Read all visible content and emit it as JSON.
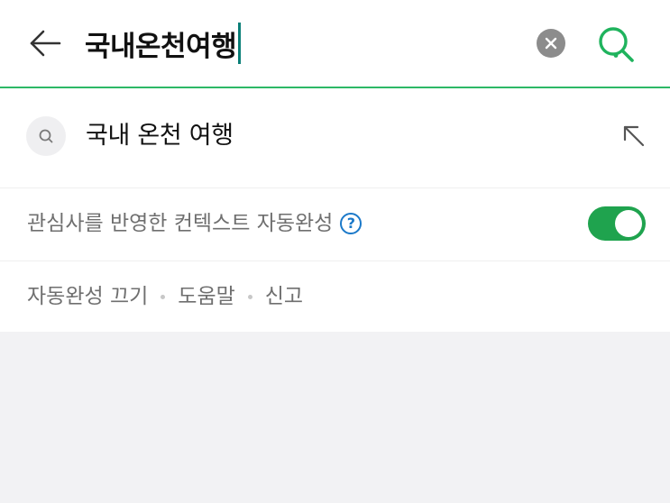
{
  "search": {
    "query": "국내온천여행"
  },
  "suggestions": [
    {
      "text": "국내 온천 여행"
    }
  ],
  "context_autocomplete": {
    "label": "관심사를 반영한 컨텍스트 자동완성",
    "help": "?",
    "enabled": true
  },
  "footer_links": {
    "disable_autocomplete": "자동완성 끄기",
    "help": "도움말",
    "report": "신고"
  },
  "colors": {
    "accent": "#2db866",
    "toggle_on": "#1fa34e",
    "help_blue": "#1b79c9",
    "caret": "#0b7f78"
  },
  "icons": {
    "back": "arrow-left-icon",
    "clear": "clear-circle-icon",
    "search": "search-icon",
    "suggestion": "search-small-icon",
    "fill": "arrow-up-left-icon",
    "help": "question-circle-icon"
  }
}
